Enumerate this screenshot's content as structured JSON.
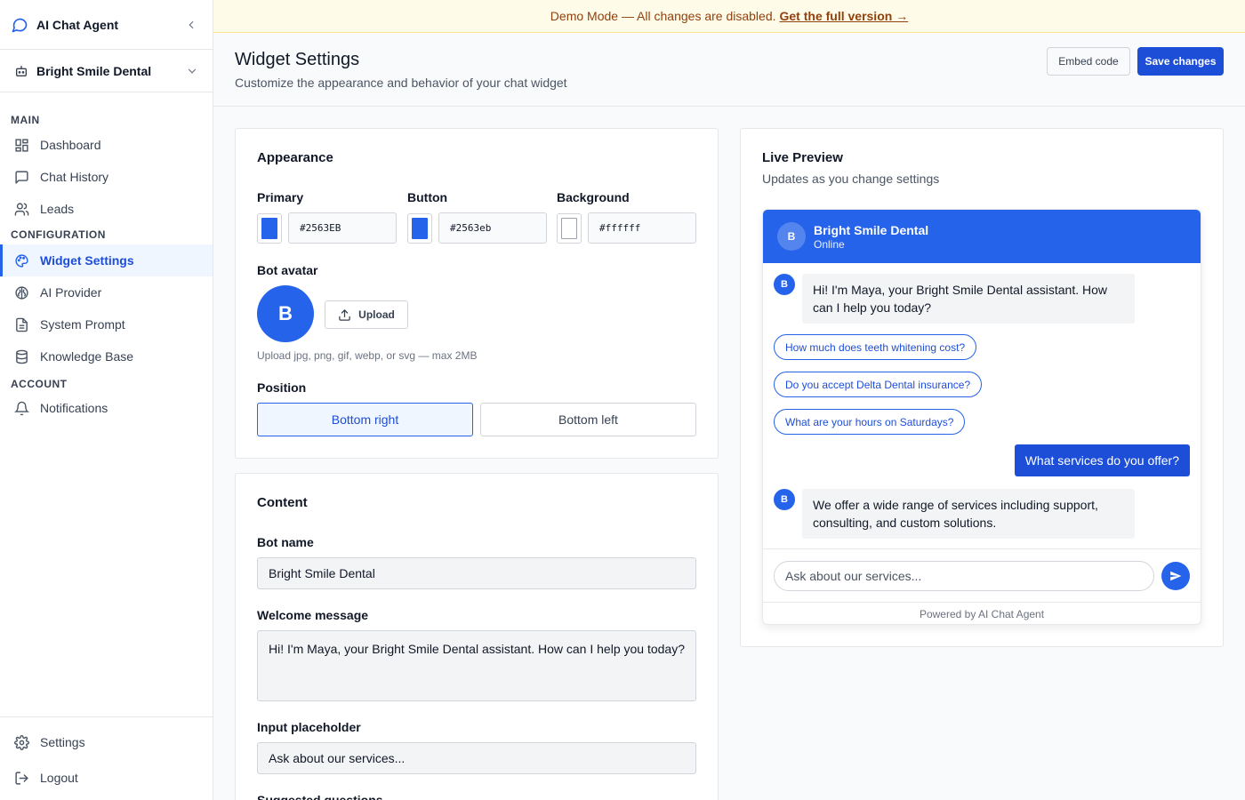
{
  "sidebar": {
    "app_title": "AI Chat Agent",
    "org_name": "Bright Smile Dental",
    "sections": {
      "main": "MAIN",
      "configuration": "CONFIGURATION",
      "account": "ACCOUNT"
    },
    "main_items": [
      {
        "label": "Dashboard",
        "icon": "dashboard-icon"
      },
      {
        "label": "Chat History",
        "icon": "chat-icon"
      },
      {
        "label": "Leads",
        "icon": "users-icon"
      }
    ],
    "config_items": [
      {
        "label": "Widget Settings",
        "icon": "palette-icon",
        "active": true
      },
      {
        "label": "AI Provider",
        "icon": "brain-icon"
      },
      {
        "label": "System Prompt",
        "icon": "document-icon"
      },
      {
        "label": "Knowledge Base",
        "icon": "database-icon"
      }
    ],
    "account_items": [
      {
        "label": "Notifications",
        "icon": "bell-icon"
      }
    ],
    "bottom_items": [
      {
        "label": "Settings",
        "icon": "gear-icon"
      },
      {
        "label": "Logout",
        "icon": "logout-icon"
      }
    ]
  },
  "banner": {
    "text": "Demo Mode — All changes are disabled.",
    "link": "Get the full version →"
  },
  "header": {
    "title": "Widget Settings",
    "subtitle": "Customize the appearance and behavior of your chat widget",
    "embed_label": "Embed code",
    "save_label": "Save changes"
  },
  "appearance": {
    "title": "Appearance",
    "colors": [
      {
        "label": "Primary",
        "value": "#2563EB",
        "swatch": "#2563eb"
      },
      {
        "label": "Button",
        "value": "#2563eb",
        "swatch": "#2563eb"
      },
      {
        "label": "Background",
        "value": "#ffffff",
        "swatch": "#ffffff"
      }
    ],
    "avatar_label": "Bot avatar",
    "avatar_letter": "B",
    "upload_label": "Upload",
    "upload_hint": "Upload jpg, png, gif, webp, or svg — max 2MB",
    "position_label": "Position",
    "position_options": [
      "Bottom right",
      "Bottom left"
    ],
    "position_selected": "Bottom right"
  },
  "content": {
    "title": "Content",
    "bot_name_label": "Bot name",
    "bot_name": "Bright Smile Dental",
    "welcome_label": "Welcome message",
    "welcome": "Hi! I'm Maya, your Bright Smile Dental assistant. How can I help you today?",
    "placeholder_label": "Input placeholder",
    "placeholder": "Ask about our services...",
    "suggested_label": "Suggested questions"
  },
  "preview": {
    "title": "Live Preview",
    "subtitle": "Updates as you change settings",
    "bot_name": "Bright Smile Dental",
    "status": "Online",
    "avatar_letter": "B",
    "welcome": "Hi! I'm Maya, your Bright Smile Dental assistant. How can I help you today?",
    "chips": [
      "How much does teeth whitening cost?",
      "Do you accept Delta Dental insurance?",
      "What are your hours on Saturdays?"
    ],
    "user_message": "What services do you offer?",
    "bot_reply": "We offer a wide range of services including support, consulting, and custom solutions.",
    "input_placeholder": "Ask about our services...",
    "footer": "Powered by AI Chat Agent",
    "accent": "#2563eb"
  }
}
